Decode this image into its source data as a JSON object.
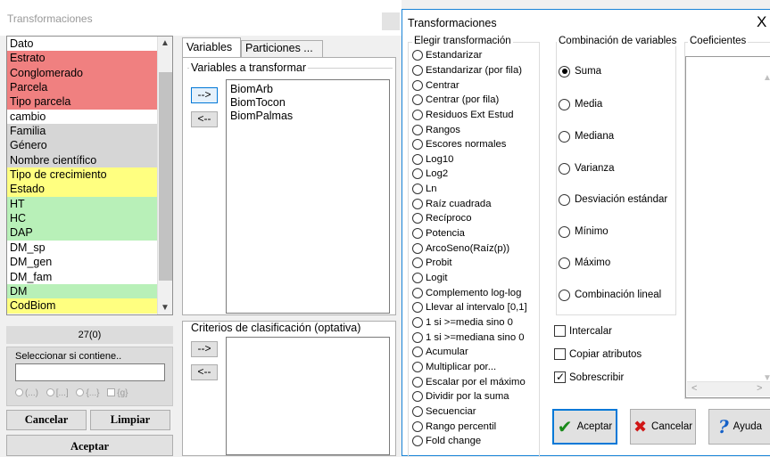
{
  "background_window": {
    "title": "Transformaciones",
    "variables": [
      {
        "label": "Dato",
        "color": "#ffffff"
      },
      {
        "label": "Estrato",
        "color": "#f08080"
      },
      {
        "label": "Conglomerado",
        "color": "#f08080"
      },
      {
        "label": "Parcela",
        "color": "#f08080"
      },
      {
        "label": "Tipo parcela",
        "color": "#f08080"
      },
      {
        "label": "cambio",
        "color": "#ffffff"
      },
      {
        "label": "Familia",
        "color": "#d6d6d6"
      },
      {
        "label": "Género",
        "color": "#d6d6d6"
      },
      {
        "label": "Nombre científico",
        "color": "#d6d6d6"
      },
      {
        "label": "Tipo de crecimiento",
        "color": "#ffff80"
      },
      {
        "label": "Estado",
        "color": "#ffff80"
      },
      {
        "label": "HT",
        "color": "#b8f0b8"
      },
      {
        "label": "HC",
        "color": "#b8f0b8"
      },
      {
        "label": "DAP",
        "color": "#b8f0b8"
      },
      {
        "label": "DM_sp",
        "color": "#ffffff"
      },
      {
        "label": "DM_gen",
        "color": "#ffffff"
      },
      {
        "label": "DM_fam",
        "color": "#ffffff"
      },
      {
        "label": "DM",
        "color": "#b8f0b8"
      },
      {
        "label": "CodBiom",
        "color": "#ffff80"
      }
    ],
    "count": "27(0)",
    "filter": {
      "label": "Seleccionar si contiene..",
      "value": "",
      "options": [
        "(...)",
        "[...]",
        "{...}",
        "{g}"
      ]
    },
    "buttons": {
      "cancel": "Cancelar",
      "clear": "Limpiar",
      "accept": "Aceptar"
    },
    "tabs": {
      "variables": "Variables",
      "partitions": "Particiones ..."
    },
    "transform_group": {
      "title": "Variables a transformar",
      "move_right": "-->",
      "move_left": "<--",
      "selected": [
        "BiomArb",
        "BiomTocon",
        "BiomPalmas"
      ]
    },
    "criteria_group": {
      "title": "Criterios de clasificación (optativa)",
      "move_right": "-->",
      "move_left": "<--"
    }
  },
  "dialog": {
    "title": "Transformaciones",
    "close_label": "X",
    "transform_title": "Elegir transformación",
    "transforms": [
      "Estandarizar",
      "Estandarizar (por fila)",
      "Centrar",
      "Centrar (por fila)",
      "Residuos Ext Estud",
      "Rangos",
      "Escores normales",
      "Log10",
      "Log2",
      "Ln",
      "Raíz cuadrada",
      "Recíproco",
      "Potencia",
      "ArcoSeno(Raíz(p))",
      "Probit",
      "Logit",
      "Complemento log-log",
      "Llevar al intervalo [0,1]",
      "1 si >=media sino 0",
      "1 si >=mediana sino 0",
      "Acumular",
      "Multiplicar por...",
      "Escalar por el máximo",
      "Dividir por la suma",
      "Secuenciar",
      "Rango percentil",
      "Fold change"
    ],
    "combination_title": "Combinación de variables",
    "combinations": [
      "Suma",
      "Media",
      "Mediana",
      "Varianza",
      "Desviación estándar",
      "Mínimo",
      "Máximo",
      "Combinación lineal"
    ],
    "combination_selected": "Suma",
    "coefficients_title": "Coeficientes",
    "checkboxes": [
      {
        "label": "Intercalar",
        "checked": false
      },
      {
        "label": "Copiar atributos",
        "checked": false
      },
      {
        "label": "Sobrescribir",
        "checked": true
      }
    ],
    "buttons": {
      "accept": "Aceptar",
      "cancel": "Cancelar",
      "help": "Ayuda"
    },
    "accent_color": "#0078d7"
  }
}
